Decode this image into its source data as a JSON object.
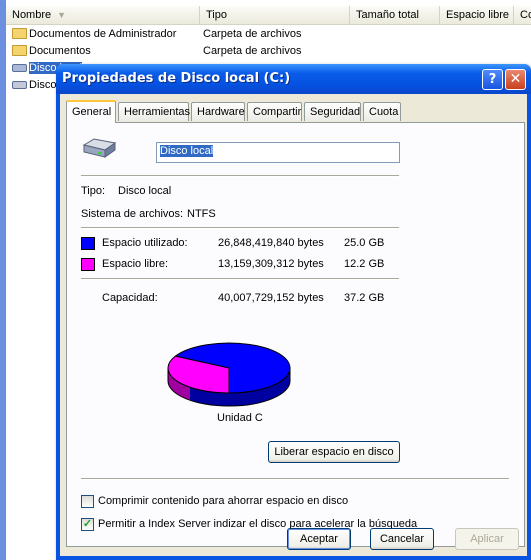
{
  "explorer": {
    "columns": [
      "Nombre",
      "Tipo",
      "Tamaño total",
      "Espacio libre",
      "Co"
    ],
    "rows": [
      {
        "name": "Documentos de Administrador",
        "type": "Carpeta de archivos"
      },
      {
        "name": "Documentos",
        "type": "Carpeta de archivos"
      },
      {
        "name": "Disco local",
        "type": ""
      },
      {
        "name": "Disco",
        "type": ""
      }
    ]
  },
  "dialog": {
    "title": "Propiedades de Disco local (C:)",
    "help_label": "?",
    "close_label": "✕",
    "tabs": [
      {
        "label": "General",
        "active": true
      },
      {
        "label": "Herramientas",
        "active": false
      },
      {
        "label": "Hardware",
        "active": false
      },
      {
        "label": "Compartir",
        "active": false
      },
      {
        "label": "Seguridad",
        "active": false
      },
      {
        "label": "Cuota",
        "active": false
      }
    ],
    "general": {
      "volume_name": "Disco local",
      "type_label": "Tipo:",
      "type_value": "Disco local",
      "fs_label": "Sistema de archivos:",
      "fs_value": "NTFS",
      "used_label": "Espacio utilizado:",
      "used_bytes": "26,848,419,840 bytes",
      "used_gb": "25.0 GB",
      "free_label": "Espacio libre:",
      "free_bytes": "13,159,309,312 bytes",
      "free_gb": "12.2 GB",
      "capacity_label": "Capacidad:",
      "capacity_bytes": "40,007,729,152 bytes",
      "capacity_gb": "37.2 GB",
      "used_fraction": 0.671,
      "drive_label": "Unidad C",
      "cleanup_button": "Liberar espacio en disco",
      "compress_label": "Comprimir contenido para ahorrar espacio en disco",
      "compress_checked": false,
      "index_label": "Permitir a Index Server indizar el disco para acelerar la búsqueda",
      "index_checked": true
    },
    "buttons": {
      "ok": "Aceptar",
      "cancel": "Cancelar",
      "apply": "Aplicar"
    }
  },
  "colors": {
    "used": "#0000ff",
    "free": "#ff00ff",
    "titlebar": "#0a5de8"
  },
  "icons": {
    "folder": "folder-icon",
    "drive": "hard-drive-icon",
    "help": "help-icon",
    "close": "close-icon",
    "checkmark": "checkmark-icon"
  }
}
